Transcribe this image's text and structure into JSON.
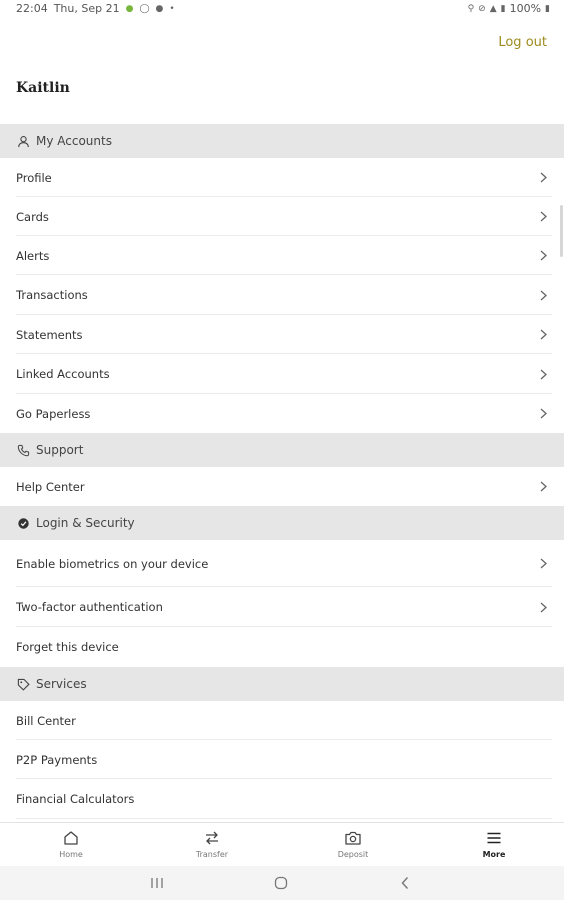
{
  "status_bar": {
    "time": "22:04",
    "date": "Thu, Sep 21",
    "battery": "100%"
  },
  "header": {
    "logout_label": "Log out",
    "user_name": "Kaitlin"
  },
  "sections": {
    "my_accounts": {
      "title": "My Accounts",
      "items": [
        "Profile",
        "Cards",
        "Alerts",
        "Transactions",
        "Statements",
        "Linked Accounts",
        "Go Paperless"
      ]
    },
    "support": {
      "title": "Support",
      "items": [
        "Help Center"
      ]
    },
    "login_security": {
      "title": "Login & Security",
      "items": [
        "Enable biometrics on your device",
        "Two-factor authentication",
        "Forget this device"
      ]
    },
    "services": {
      "title": "Services",
      "items": [
        "Bill Center",
        "P2P Payments",
        "Financial Calculators"
      ]
    }
  },
  "bottom_nav": {
    "home": "Home",
    "transfer": "Transfer",
    "deposit": "Deposit",
    "more": "More"
  },
  "colors": {
    "accent": "#9c8b1e",
    "section_bg": "#e6e6e6"
  }
}
